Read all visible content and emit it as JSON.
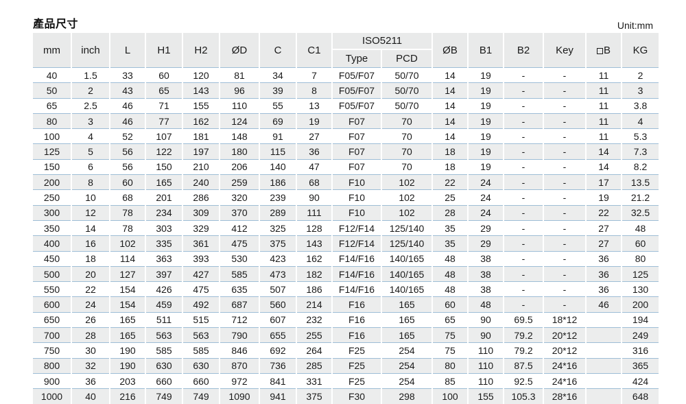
{
  "header": {
    "title": "產品尺寸",
    "unit_label": "Unit:mm"
  },
  "table": {
    "group_header": {
      "iso_label": "ISO5211"
    },
    "columns": [
      {
        "key": "mm",
        "label": "mm"
      },
      {
        "key": "inch",
        "label": "inch"
      },
      {
        "key": "L",
        "label": "L"
      },
      {
        "key": "H1",
        "label": "H1"
      },
      {
        "key": "H2",
        "label": "H2"
      },
      {
        "key": "OD",
        "label": "ØD"
      },
      {
        "key": "C",
        "label": "C"
      },
      {
        "key": "C1",
        "label": "C1"
      },
      {
        "key": "type",
        "label": "Type"
      },
      {
        "key": "pcd",
        "label": "PCD"
      },
      {
        "key": "OB",
        "label": "ØB"
      },
      {
        "key": "B1",
        "label": "B1"
      },
      {
        "key": "B2",
        "label": "B2"
      },
      {
        "key": "key",
        "label": "Key"
      },
      {
        "key": "sqB",
        "label": "B"
      },
      {
        "key": "KG",
        "label": "KG"
      }
    ],
    "rows": [
      [
        "40",
        "1.5",
        "33",
        "60",
        "120",
        "81",
        "34",
        "7",
        "F05/F07",
        "50/70",
        "14",
        "19",
        "-",
        "-",
        "11",
        "2"
      ],
      [
        "50",
        "2",
        "43",
        "65",
        "143",
        "96",
        "39",
        "8",
        "F05/F07",
        "50/70",
        "14",
        "19",
        "-",
        "-",
        "11",
        "3"
      ],
      [
        "65",
        "2.5",
        "46",
        "71",
        "155",
        "110",
        "55",
        "13",
        "F05/F07",
        "50/70",
        "14",
        "19",
        "-",
        "-",
        "11",
        "3.8"
      ],
      [
        "80",
        "3",
        "46",
        "77",
        "162",
        "124",
        "69",
        "19",
        "F07",
        "70",
        "14",
        "19",
        "-",
        "-",
        "11",
        "4"
      ],
      [
        "100",
        "4",
        "52",
        "107",
        "181",
        "148",
        "91",
        "27",
        "F07",
        "70",
        "14",
        "19",
        "-",
        "-",
        "11",
        "5.3"
      ],
      [
        "125",
        "5",
        "56",
        "122",
        "197",
        "180",
        "115",
        "36",
        "F07",
        "70",
        "18",
        "19",
        "-",
        "-",
        "14",
        "7.3"
      ],
      [
        "150",
        "6",
        "56",
        "150",
        "210",
        "206",
        "140",
        "47",
        "F07",
        "70",
        "18",
        "19",
        "-",
        "-",
        "14",
        "8.2"
      ],
      [
        "200",
        "8",
        "60",
        "165",
        "240",
        "259",
        "186",
        "68",
        "F10",
        "102",
        "22",
        "24",
        "-",
        "-",
        "17",
        "13.5"
      ],
      [
        "250",
        "10",
        "68",
        "201",
        "286",
        "320",
        "239",
        "90",
        "F10",
        "102",
        "25",
        "24",
        "-",
        "-",
        "19",
        "21.2"
      ],
      [
        "300",
        "12",
        "78",
        "234",
        "309",
        "370",
        "289",
        "111",
        "F10",
        "102",
        "28",
        "24",
        "-",
        "-",
        "22",
        "32.5"
      ],
      [
        "350",
        "14",
        "78",
        "303",
        "329",
        "412",
        "325",
        "128",
        "F12/F14",
        "125/140",
        "35",
        "29",
        "-",
        "-",
        "27",
        "48"
      ],
      [
        "400",
        "16",
        "102",
        "335",
        "361",
        "475",
        "375",
        "143",
        "F12/F14",
        "125/140",
        "35",
        "29",
        "-",
        "-",
        "27",
        "60"
      ],
      [
        "450",
        "18",
        "114",
        "363",
        "393",
        "530",
        "423",
        "162",
        "F14/F16",
        "140/165",
        "48",
        "38",
        "-",
        "-",
        "36",
        "80"
      ],
      [
        "500",
        "20",
        "127",
        "397",
        "427",
        "585",
        "473",
        "182",
        "F14/F16",
        "140/165",
        "48",
        "38",
        "-",
        "-",
        "36",
        "125"
      ],
      [
        "550",
        "22",
        "154",
        "426",
        "475",
        "635",
        "507",
        "186",
        "F14/F16",
        "140/165",
        "48",
        "38",
        "-",
        "-",
        "36",
        "130"
      ],
      [
        "600",
        "24",
        "154",
        "459",
        "492",
        "687",
        "560",
        "214",
        "F16",
        "165",
        "60",
        "48",
        "-",
        "-",
        "46",
        "200"
      ],
      [
        "650",
        "26",
        "165",
        "511",
        "515",
        "712",
        "607",
        "232",
        "F16",
        "165",
        "65",
        "90",
        "69.5",
        "18*12",
        "",
        "194"
      ],
      [
        "700",
        "28",
        "165",
        "563",
        "563",
        "790",
        "655",
        "255",
        "F16",
        "165",
        "75",
        "90",
        "79.2",
        "20*12",
        "",
        "249"
      ],
      [
        "750",
        "30",
        "190",
        "585",
        "585",
        "846",
        "692",
        "264",
        "F25",
        "254",
        "75",
        "110",
        "79.2",
        "20*12",
        "",
        "316"
      ],
      [
        "800",
        "32",
        "190",
        "630",
        "630",
        "870",
        "736",
        "285",
        "F25",
        "254",
        "80",
        "110",
        "87.5",
        "24*16",
        "",
        "365"
      ],
      [
        "900",
        "36",
        "203",
        "660",
        "660",
        "972",
        "841",
        "331",
        "F25",
        "254",
        "85",
        "110",
        "92.5",
        "24*16",
        "",
        "424"
      ],
      [
        "1000",
        "40",
        "216",
        "749",
        "749",
        "1090",
        "941",
        "375",
        "F30",
        "298",
        "100",
        "155",
        "105.3",
        "28*16",
        "",
        "648"
      ]
    ]
  },
  "colors": {
    "row_separator": "#9dbdd6",
    "header_bg": "#e9eaea",
    "shaded_row_bg": "#eceded",
    "text": "#1a1a1a"
  }
}
